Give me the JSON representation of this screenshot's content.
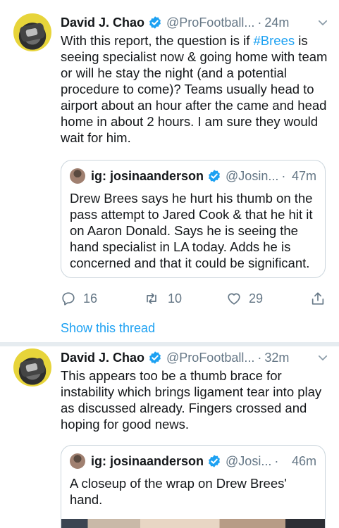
{
  "tweets": [
    {
      "author": "David J. Chao",
      "handle": "@ProFootball...",
      "dot": "·",
      "time": "24m",
      "text_before": "With this report, the question is if ",
      "hashtag": "#Brees",
      "text_after": " is seeing specialist now & going home with team or will he stay the night (and a potential procedure to come)? Teams usually head to airport about an hour after the came and head home in about 2 hours. I am sure they would wait for him.",
      "quote": {
        "author": "ig: josinaanderson",
        "handle": "@Josin...",
        "dot": "·",
        "time": "47m",
        "text": "Drew Brees says he hurt his thumb on the pass attempt to Jared Cook & that he hit it on Aaron Donald. Says he is seeing the hand specialist in LA today. Adds he is concerned and that it could be significant."
      },
      "replies": "16",
      "retweets": "10",
      "likes": "29",
      "thread_link": "Show this thread"
    },
    {
      "author": "David J. Chao",
      "handle": "@ProFootball...",
      "dot": "·",
      "time": "32m",
      "text": "This appears too be a thumb brace for instability which brings ligament tear into play as discussed already. Fingers crossed and hoping for good news.",
      "quote": {
        "author": "ig: josinaanderson",
        "handle": "@Josi...",
        "dot": "·",
        "time": "46m",
        "text": "A closeup of the wrap on Drew Brees' hand."
      }
    }
  ],
  "colors": {
    "accent": "#1da1f2",
    "text": "#14171a",
    "secondary": "#657786",
    "border": "#ccd6dd",
    "divider": "#e6ecf0"
  },
  "icons": [
    "verified-badge-icon",
    "chevron-down-icon",
    "reply-icon",
    "retweet-icon",
    "like-icon",
    "share-icon"
  ]
}
